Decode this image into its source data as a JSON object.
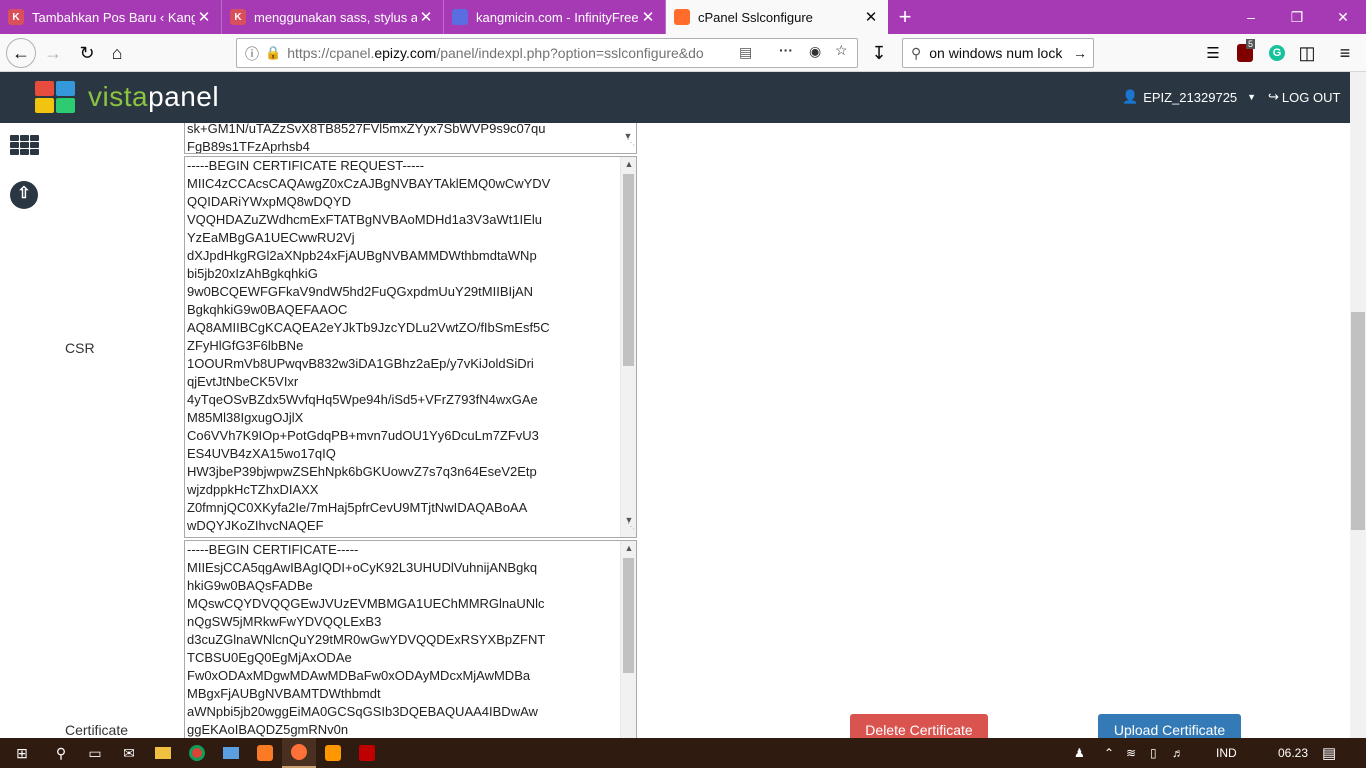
{
  "browser": {
    "tabs": [
      {
        "title": "Tambahkan Pos Baru ‹ Kangmicin",
        "favicon": "k-icon",
        "color": "#d94f5c",
        "active": false
      },
      {
        "title": "menggunakan sass, stylus atau less",
        "favicon": "k-icon",
        "color": "#d94f5c",
        "active": false
      },
      {
        "title": "kangmicin.com - InfinityFree",
        "favicon": "infinityfree-icon",
        "color": "#5b6ee1",
        "active": false
      },
      {
        "title": "cPanel Sslconfigure",
        "favicon": "cpanel-icon",
        "color": "#ff6c2c",
        "active": true
      }
    ],
    "url_prefix": "https://cpanel.",
    "url_domain": "epizy.com",
    "url_path": "/panel/indexpl.php?option=sslconfigure&do",
    "search_value": "on windows num lock",
    "ublock_badge": "5"
  },
  "vistapanel": {
    "logo_vista": "vista",
    "logo_panel": "panel",
    "username": "EPIZ_21329725",
    "logout_label": "LOG OUT"
  },
  "form": {
    "key_tail": [
      "sk+GM1N/uTAZzSvX8TB8527FVl5mxZYyx7SbWVP9s9c07qu",
      "FgB89s1TFzAprhsb4"
    ],
    "csr_label": "CSR",
    "csr_lines": [
      "-----BEGIN CERTIFICATE REQUEST-----",
      "MIIC4zCCAcsCAQAwgZ0xCzAJBgNVBAYTAklEMQ0wCwYDV",
      "QQIDARiYWxpMQ8wDQYD",
      "VQQHDAZuZWdhcmExFTATBgNVBAoMDHd1a3V3aWt1IElu",
      "YzEaMBgGA1UECwwRU2Vj",
      "dXJpdHkgRGl2aXNpb24xFjAUBgNVBAMMDWthbmdtaWNp",
      "bi5jb20xIzAhBgkqhkiG",
      "9w0BCQEWFGFkaV9ndW5hd2FuQGxpdmUuY29tMIIBIjAN",
      "BgkqhkiG9w0BAQEFAAOC",
      "AQ8AMIIBCgKCAQEA2eYJkTb9JzcYDLu2VwtZO/fIbSmEsf5C",
      "ZFyHlGfG3F6lbBNe",
      "1OOURmVb8UPwqvB832w3iDA1GBhz2aEp/y7vKiJoldSiDri",
      "qjEvtJtNbeCK5VIxr",
      "4yTqeOSvBZdx5WvfqHq5Wpe94h/iSd5+VFrZ793fN4wxGAe",
      "M85Ml38IgxugOJjlX",
      "Co6VVh7K9IOp+PotGdqPB+mvn7udOU1Yy6DcuLm7ZFvU3",
      "ES4UVB4zXA15wo17qIQ",
      "HW3jbeP39bjwpwZSEhNpk6bGKUowvZ7s7q3n64EseV2Etp",
      "wjzdppkHcTZhxDIAXX",
      "Z0fmnjQC0XKyfa2Ie/7mHaj5pfrCevU9MTjtNwIDAQABoAA",
      "wDQYJKoZIhvcNAQEF"
    ],
    "cert_label": "Certificate",
    "cert_lines": [
      "-----BEGIN CERTIFICATE-----",
      "MIIEsjCCA5qgAwIBAgIQDI+oCyK92L3UHUDlVuhnijANBgkq",
      "hkiG9w0BAQsFADBe",
      "MQswCQYDVQQGEwJVUzEVMBMGA1UEChMMRGlnaUNlc",
      "nQgSW5jMRkwFwYDVQQLExB3",
      "d3cuZGlnaWNlcnQuY29tMR0wGwYDVQQDExRSYXBpZFNT",
      "TCBSU0EgQ0EgMjAxODAe",
      "Fw0xODAxMDgwMDAwMDBaFw0xODAyMDcxMjAwMDBa",
      "MBgxFjAUBgNVBAMTDWthbmdt",
      "aWNpbi5jb20wggEiMA0GCSqGSIb3DQEBAQUAA4IBDwAw",
      "ggEKAoIBAQDZ5gmRNv0n"
    ],
    "delete_label": "Delete Certificate",
    "upload_label": "Upload Certificate",
    "delete_color": "#d9534f",
    "upload_color": "#337ab7"
  },
  "taskbar": {
    "language": "IND",
    "time": "06.23"
  }
}
